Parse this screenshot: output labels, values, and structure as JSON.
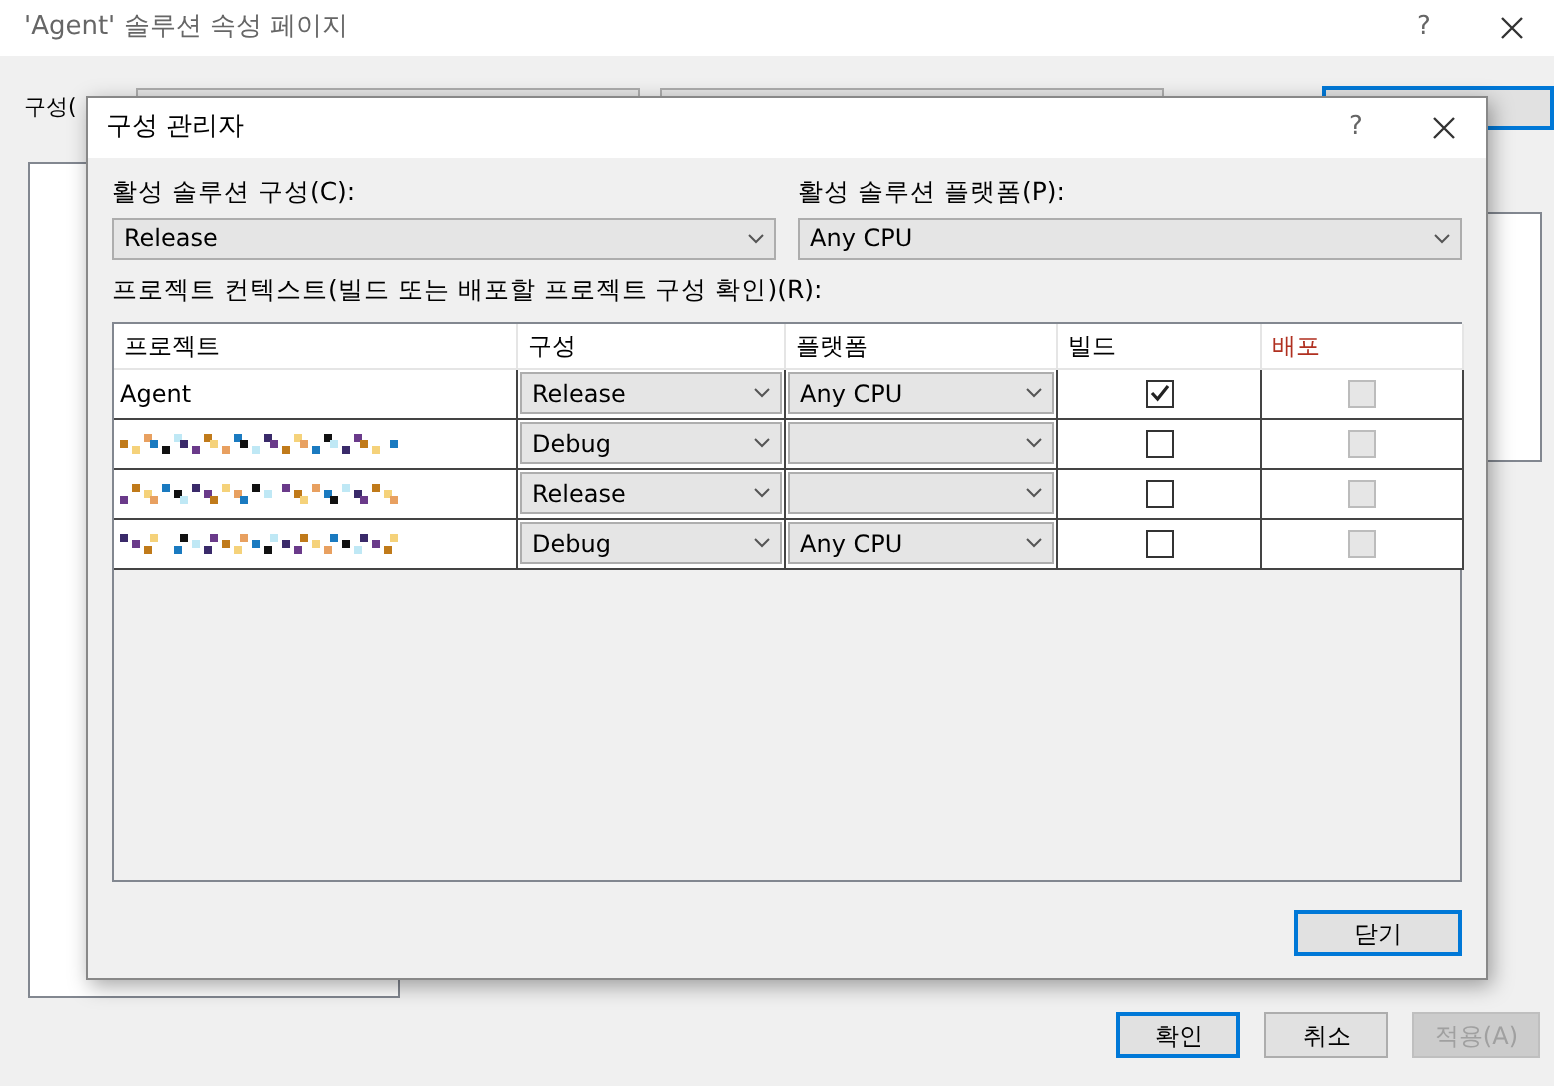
{
  "window": {
    "title": "'Agent' 솔루션 속성 페이지",
    "help": "?"
  },
  "background": {
    "config_label": "구성(",
    "buttons": [
      {
        "label": "확인",
        "default": true,
        "disabled": false
      },
      {
        "label": "취소",
        "default": false,
        "disabled": false
      },
      {
        "label": "적용(A)",
        "default": false,
        "disabled": true
      }
    ]
  },
  "dialog": {
    "title": "구성 관리자",
    "help": "?",
    "active_config": {
      "label": "활성 솔루션 구성(C):",
      "value": "Release"
    },
    "active_platform": {
      "label": "활성 솔루션 플랫폼(P):",
      "value": "Any CPU"
    },
    "context_label": "프로젝트 컨텍스트(빌드 또는 배포할 프로젝트 구성 확인)(R):",
    "columns": [
      {
        "label": "프로젝트",
        "accent": false
      },
      {
        "label": "구성",
        "accent": false
      },
      {
        "label": "플랫폼",
        "accent": false
      },
      {
        "label": "빌드",
        "accent": false
      },
      {
        "label": "배포",
        "accent": true
      }
    ],
    "rows": [
      {
        "kind": "named",
        "project": "Agent",
        "config": "Release",
        "platform": "Any CPU",
        "build": true,
        "deploy": false,
        "deploy_disabled": true
      },
      {
        "kind": "redacted",
        "config": "Debug",
        "build": false,
        "deploy": false,
        "deploy_disabled": true
      },
      {
        "kind": "redacted",
        "config": "Release",
        "build": false,
        "deploy": false,
        "deploy_disabled": true
      },
      {
        "kind": "redacted",
        "config": "Debug",
        "platform": "Any CPU",
        "build": false,
        "deploy": false,
        "deploy_disabled": true
      }
    ],
    "close_button": "닫기"
  }
}
